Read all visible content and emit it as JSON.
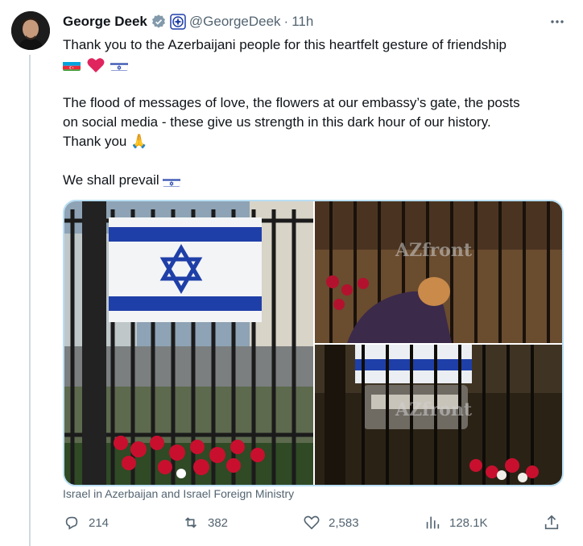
{
  "author": {
    "name": "George Deek",
    "handle": "@GeorgeDeek",
    "separator": "·",
    "time": "11h"
  },
  "tweet": {
    "line1": "Thank you to the Azerbaijani people for this heartfelt gesture of friendship",
    "para2_l1": "The flood of messages of love, the flowers at our embassy’s gate, the posts",
    "para2_l2": "on social media - these give us strength in  this dark hour of our history.",
    "para2_l3": "Thank you",
    "line_last": "We shall prevail",
    "emoji_pray": "🙏"
  },
  "media": {
    "watermark_top": "AZfront",
    "watermark_bottom": "AZfront",
    "caption": "Israel in Azerbaijan and Israel Foreign Ministry"
  },
  "actions": {
    "replies": "214",
    "reposts": "382",
    "likes": "2,583",
    "views": "128.1K"
  },
  "colors": {
    "verified": "#536471",
    "accent": "#1d9bf0",
    "israel_blue": "#1f3fa8",
    "heart": "#e0245e"
  },
  "icons": [
    "verified-badge-icon",
    "org-badge-icon",
    "more-icon",
    "reply-icon",
    "repost-icon",
    "like-icon",
    "views-icon",
    "share-icon"
  ]
}
